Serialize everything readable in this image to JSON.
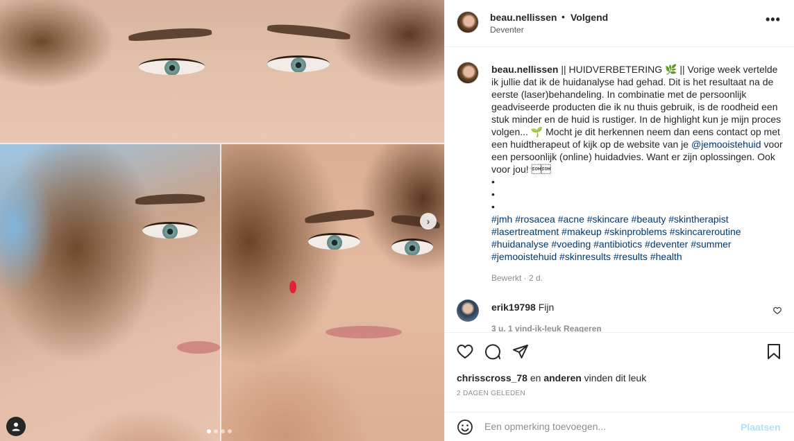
{
  "post": {
    "username": "beau.nellissen",
    "separator": "•",
    "follow_label": "Volgend",
    "location": "Deventer",
    "more_label": "•••"
  },
  "caption": {
    "username": "beau.nellissen",
    "text_part1": " || HUIDVERBETERING 🌿 || Vorige week vertelde ik jullie dat ik de huidanalyse had gehad. Dit is het resultaat na de eerste (laser)behandeling. In combinatie met de persoonlijk geadviseerde producten die ik nu thuis gebruik, is de roodheid een stuk minder en de huid is rustiger. In de highlight kun je mijn proces volgen... 🌱 Mocht je dit herkennen neem dan eens contact op met een huidtherapeut of kijk op de website van je ",
    "mention": "@jemooistehuid",
    "text_part2": " voor een persoonlijk (online) huidadvies. Want er zijn oplossingen. Ook voor jou! \u0001\u0001",
    "bullet": "•",
    "hashtags": "#jmh #rosacea #acne #skincare #beauty #skintherapist #lasertreatment #makeup #skinproblems #skincareroutine #huidanalyse #voeding #antibiotics #deventer #summer #jemooistehuid #skinresults #results #health",
    "meta": "Bewerkt · 2 d."
  },
  "comments": [
    {
      "username": "erik19798",
      "text": "Fijn",
      "sub": "3 u.   1 vind-ik-leuk   Reageren"
    }
  ],
  "likes": {
    "user": "chrisscross_78",
    "connector": " en ",
    "others": "anderen",
    "suffix": " vinden dit leuk"
  },
  "date": "2 DAGEN GELEDEN",
  "add_comment": {
    "placeholder": "Een opmerking toevoegen...",
    "post_label": "Plaatsen"
  },
  "carousel": {
    "next_label": "›",
    "slide_count": 4,
    "active_index": 0
  },
  "colors": {
    "link": "#00376b",
    "muted": "#8e8e8e",
    "post_disabled": "#b2dffc",
    "text": "#262626"
  }
}
